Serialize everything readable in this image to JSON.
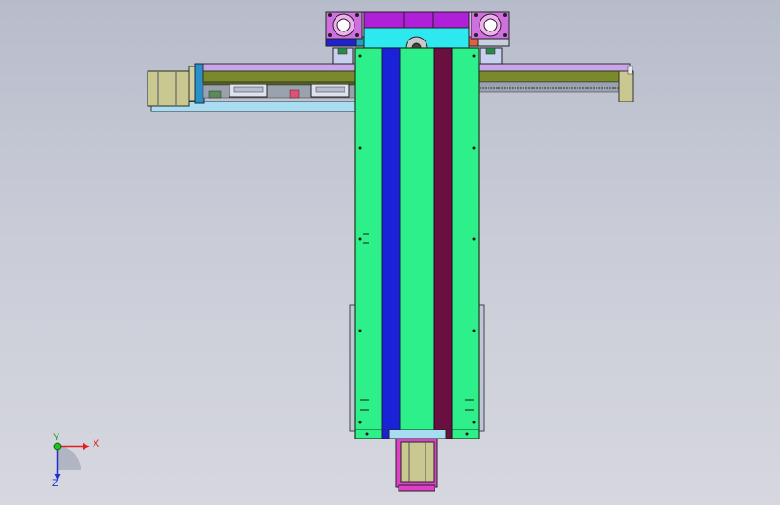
{
  "view": {
    "axis_triad": {
      "x_label": "X",
      "y_label": "Y",
      "z_label": "Z"
    }
  },
  "colors": {
    "background_top": "#b7bccb",
    "background_bottom": "#d6d7df",
    "column_green": "#2ef08a",
    "stripe_blue": "#1a22d8",
    "stripe_maroon": "#6a1040",
    "top_cap_cyan": "#2ee8f0",
    "top_block_magenta": "#b020d8",
    "arm_olive": "#7a8a2a",
    "arm_lilac": "#c9a6e8",
    "motor_khaki": "#c8c890",
    "base_lightblue": "#a8dcf0",
    "bottom_magenta": "#e040c8",
    "axis_x": "#e02020",
    "axis_y": "#20a020",
    "axis_z": "#2030d0"
  },
  "icons": {
    "triad": "coordinate-triad-icon",
    "motor_top_left": "gear-motor-icon",
    "motor_top_right": "gear-motor-icon",
    "motor_bottom": "stepper-motor-icon",
    "motor_left": "stepper-motor-icon"
  }
}
